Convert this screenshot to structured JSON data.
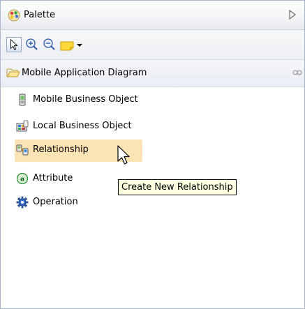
{
  "header": {
    "title": "Palette",
    "icon": "palette-icon",
    "collapse_icon": "collapse-arrow-icon"
  },
  "toolbar": {
    "tools": [
      {
        "name": "select-tool",
        "icon": "arrow-select-icon",
        "selected": true
      },
      {
        "name": "zoom-in-tool",
        "icon": "zoom-in-icon"
      },
      {
        "name": "zoom-out-tool",
        "icon": "zoom-out-icon"
      },
      {
        "name": "note-tool",
        "icon": "note-icon"
      },
      {
        "name": "tool-dropdown",
        "icon": "dropdown-arrow-icon"
      }
    ]
  },
  "drawer": {
    "label": "Mobile Application Diagram",
    "icon": "open-folder-icon",
    "pin_icon": "pin-icon"
  },
  "entries": [
    {
      "label": "Mobile Business Object",
      "icon": "mobile-business-object-icon"
    },
    {
      "label": "Local Business Object",
      "icon": "local-business-object-icon"
    },
    {
      "label": "Relationship",
      "icon": "relationship-icon",
      "hovered": true
    },
    {
      "label": "Attribute",
      "icon": "attribute-icon"
    },
    {
      "label": "Operation",
      "icon": "operation-icon"
    }
  ],
  "tooltip": {
    "text": "Create New Relationship"
  },
  "colors": {
    "hover_highlight": "#fbe3b4",
    "tooltip_bg": "#ffffe1",
    "border": "#a9b8cc"
  }
}
